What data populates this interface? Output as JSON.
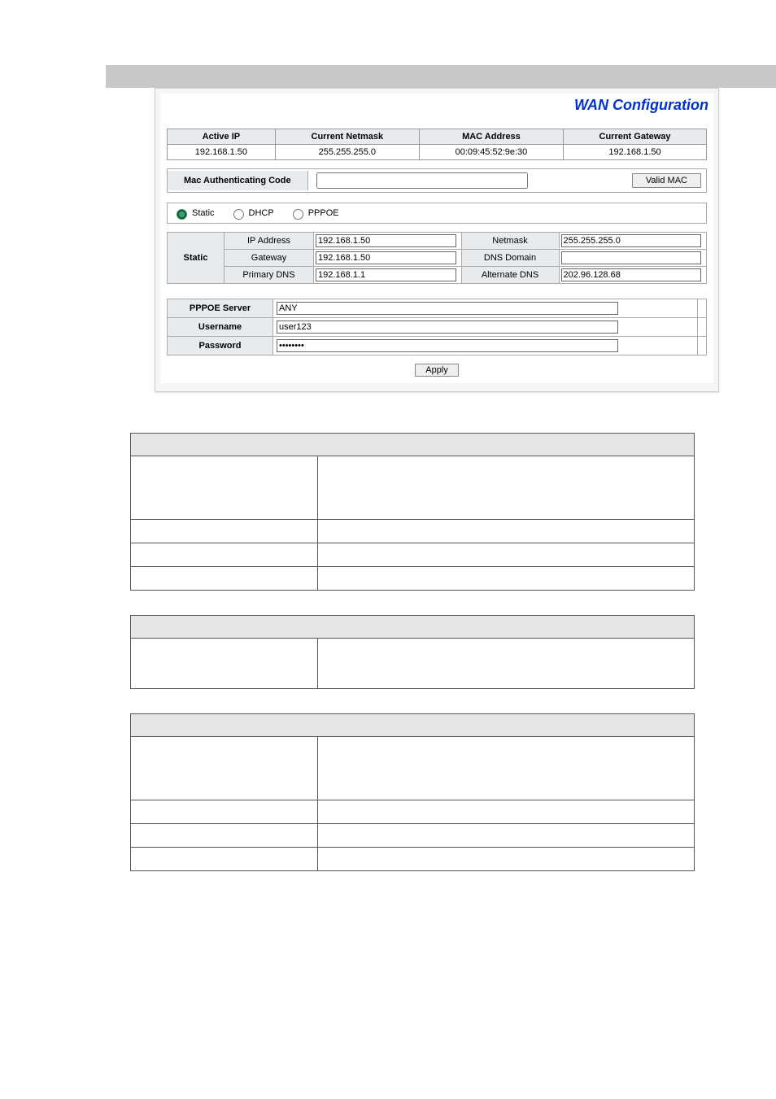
{
  "title": "WAN Configuration",
  "status": {
    "headers": [
      "Active IP",
      "Current Netmask",
      "MAC Address",
      "Current Gateway"
    ],
    "values": [
      "192.168.1.50",
      "255.255.255.0",
      "00:09:45:52:9e:30",
      "192.168.1.50"
    ]
  },
  "mac": {
    "label": "Mac Authenticating Code",
    "value": "",
    "button": "Valid MAC"
  },
  "modes": {
    "static": "Static",
    "dhcp": "DHCP",
    "pppoe": "PPPOE",
    "selected": "static"
  },
  "static_cfg": {
    "row_label": "Static",
    "ip_label": "IP Address",
    "ip_value": "192.168.1.50",
    "netmask_label": "Netmask",
    "netmask_value": "255.255.255.0",
    "gateway_label": "Gateway",
    "gateway_value": "192.168.1.50",
    "dnsdomain_label": "DNS Domain",
    "dnsdomain_value": "",
    "pdns_label": "Primary DNS",
    "pdns_value": "192.168.1.1",
    "adns_label": "Alternate DNS",
    "adns_value": "202.96.128.68"
  },
  "pppoe": {
    "server_label": "PPPOE Server",
    "server_value": "ANY",
    "user_label": "Username",
    "user_value": "user123",
    "pass_label": "Password",
    "pass_value": "••••••••"
  },
  "apply": "Apply"
}
